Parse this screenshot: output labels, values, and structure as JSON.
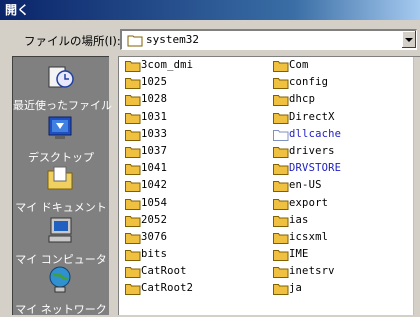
{
  "window": {
    "title": "開く"
  },
  "look_in": {
    "label": "ファイルの場所(I):",
    "value": "system32"
  },
  "places": [
    {
      "label": "最近使ったファイル",
      "icon": "recent-documents-icon"
    },
    {
      "label": "デスクトップ",
      "icon": "desktop-icon"
    },
    {
      "label": "マイ ドキュメント",
      "icon": "my-documents-icon"
    },
    {
      "label": "マイ コンピュータ",
      "icon": "my-computer-icon"
    },
    {
      "label": "マイ ネットワーク",
      "icon": "my-network-icon"
    }
  ],
  "files": {
    "column1": [
      "3com_dmi",
      "1025",
      "1028",
      "1031",
      "1033",
      "1037",
      "1041",
      "1042",
      "1054",
      "2052",
      "3076",
      "bits",
      "CatRoot",
      "CatRoot2"
    ],
    "column2": [
      "Com",
      "config",
      "dhcp",
      "DirectX",
      "dllcache",
      "drivers",
      "DRVSTORE",
      "en-US",
      "export",
      "ias",
      "icsxml",
      "IME",
      "inetsrv",
      "ja"
    ]
  },
  "colors": {
    "titlebar_start": "#0a246a",
    "folder": "#f0c040",
    "places_bg": "#808080",
    "link_blue": "#2020c0"
  }
}
